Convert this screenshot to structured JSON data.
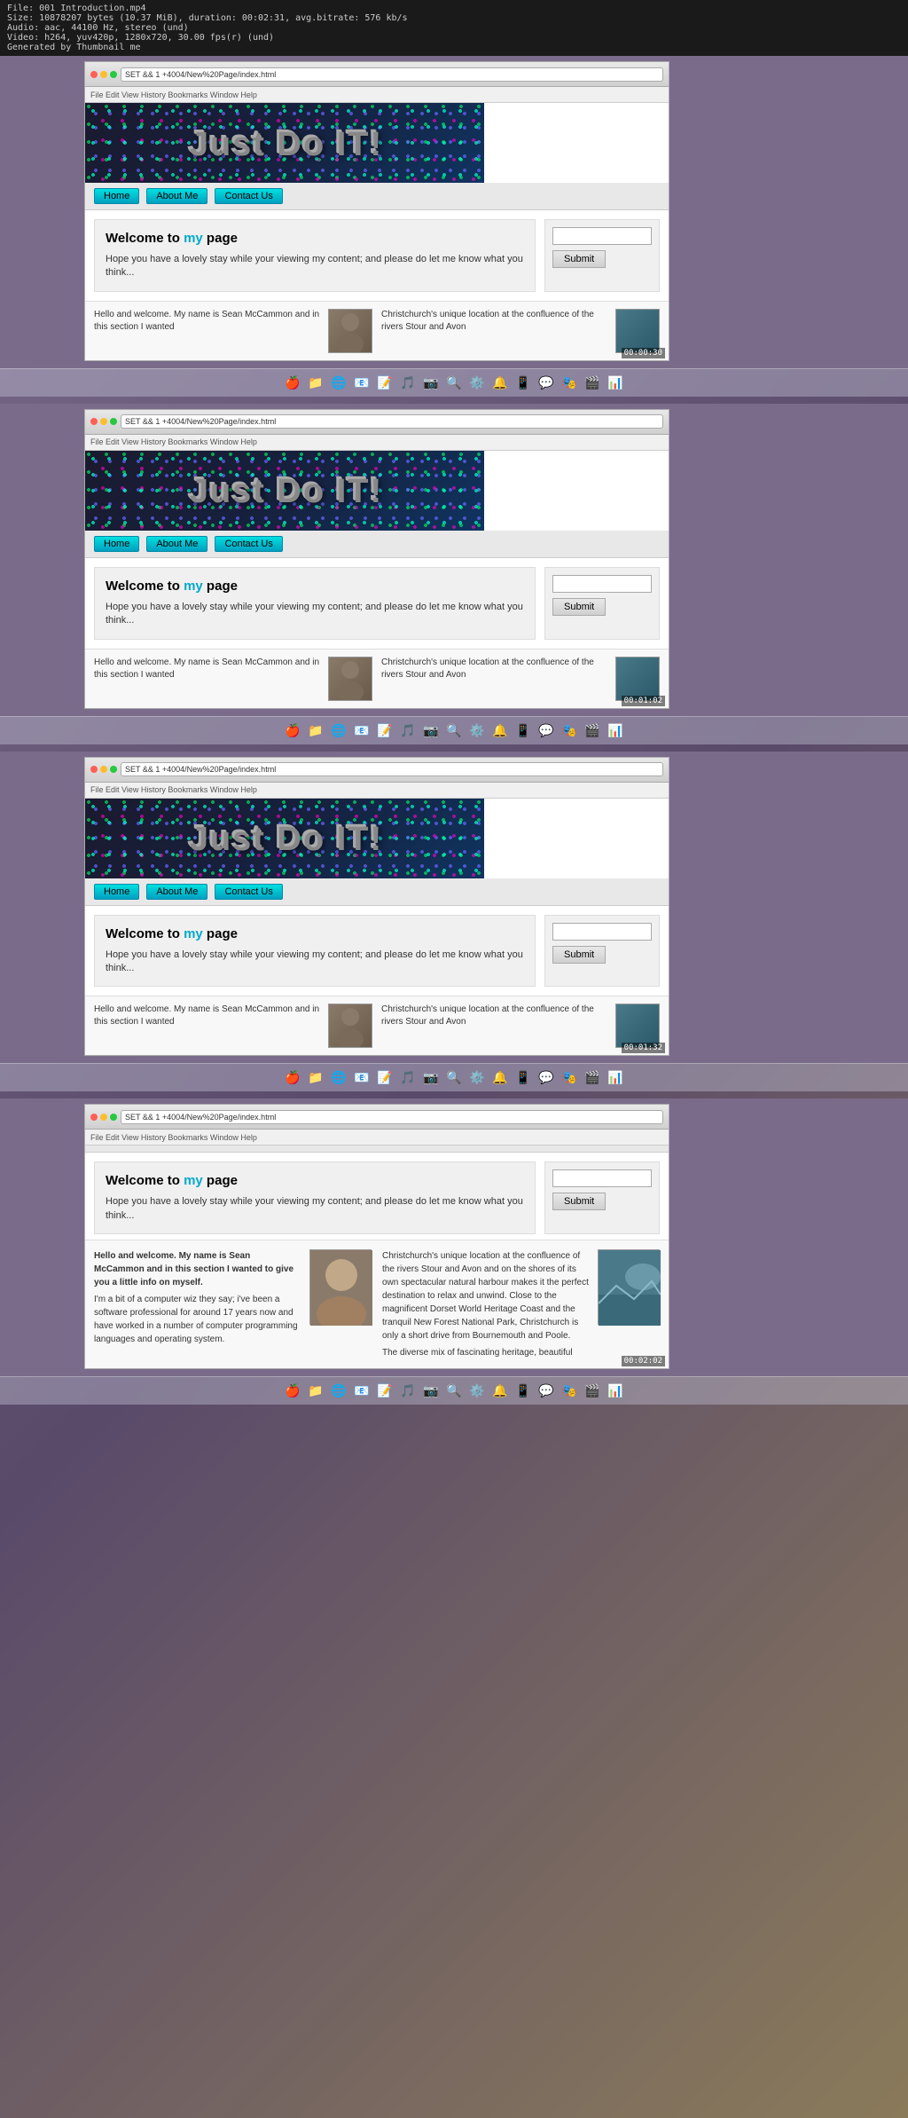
{
  "videoInfo": {
    "filename": "File: 001 Introduction.mp4",
    "size": "Size: 10878207 bytes (10.37 MiB), duration: 00:02:31, avg.bitrate: 576 kb/s",
    "audio": "Audio: aac, 44100 Hz, stereo (und)",
    "video": "Video: h264, yuv420p, 1280x720, 30.00 fps(r) (und)",
    "generatedBy": "Generated by Thumbnail me"
  },
  "site": {
    "bannerText": "Just Do IT!",
    "nav": {
      "home": "Home",
      "aboutMe": "About Me",
      "contactUs": "Contact Us"
    },
    "welcome": {
      "title": "Welcome to my page",
      "titleHighlight": "my",
      "bodyText": "Hope you have a lovely stay while your viewing my content; and please do let me know what you think..."
    },
    "sidebar": {
      "inputPlaceholder": "",
      "submitLabel": "Submit"
    },
    "belowFold": {
      "leftTitle": "Hello and welcome. My name is Sean McCammon and in this section I wanted",
      "leftFull": "Hello and welcome. My name is Sean McCammon and in this section I wanted to give you a little info on myself.\n\nI'm a bit of a computer wiz they say; i've been a software professional for around 17 years now and have worked in a number of computer programming languages and operating system.",
      "rightTitle": "Christchurch's unique location at the confluence of the rivers Stour and Avon",
      "rightFull": "Christchurch's unique location at the confluence of the rivers Stour and Avon and on the shores of its own spectacular natural harbour makes it the perfect destination to relax and unwind. Close to the magnificent Dorset World Heritage Coast and the tranquil New Forest National Park, Christchurch is only a short drive from Bournemouth and Poole.\n\nThe diverse mix of fascinating heritage, beautiful"
    }
  },
  "timestamps": {
    "seg1": "00:00:30",
    "seg2": "00:01:02",
    "seg3": "00:01:32",
    "seg4": "00:02:02"
  },
  "addressBar": "SET && 1 +4004/New%20Page/index.html",
  "dock": {
    "icons": [
      "🍎",
      "📁",
      "🌐",
      "📧",
      "📝",
      "🎵",
      "📷",
      "🔍",
      "⚙️",
      "🔔",
      "📱",
      "💬",
      "🎭",
      "🎬",
      "📊"
    ]
  }
}
